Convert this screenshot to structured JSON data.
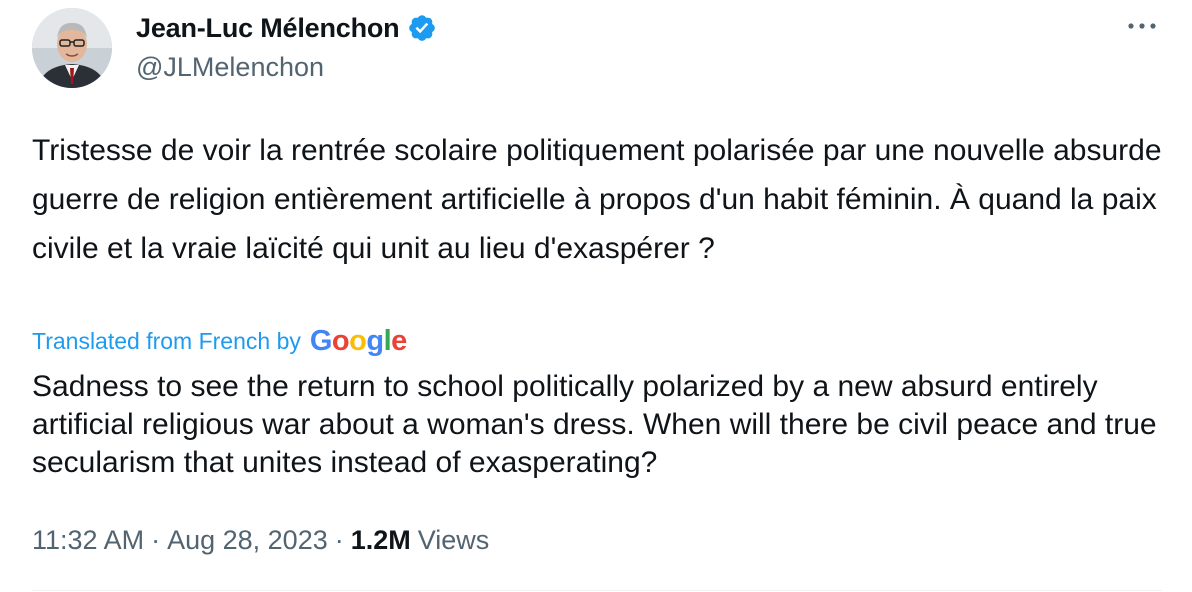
{
  "author": {
    "display_name": "Jean-Luc Mélenchon",
    "handle": "@JLMelenchon",
    "verified": true
  },
  "tweet": {
    "text": "Tristesse de voir la rentrée scolaire politiquement polarisée par une nouvelle absurde guerre de religion entièrement artificielle à propos d'un habit féminin. À quand la paix civile et la vraie laïcité qui unit au lieu d'exaspérer ?",
    "translated_label": "Translated from French by",
    "translator_brand": [
      "G",
      "o",
      "o",
      "g",
      "l",
      "e"
    ],
    "translation": "Sadness to see the return to school politically polarized by a new absurd entirely artificial religious war about a woman's dress. When will there be civil peace and true secularism that unites instead of exasperating?",
    "time": "11:32 AM",
    "date": "Aug 28, 2023",
    "separator": "·",
    "views_count": "1.2M",
    "views_label": "Views"
  },
  "icons": {
    "verified": "verified-badge-icon",
    "more": "more-options-icon"
  },
  "colors": {
    "accent": "#1d9bf0",
    "secondary_text": "#536471",
    "primary_text": "#0f1419",
    "google": [
      "#4285F4",
      "#EA4335",
      "#FBBC05",
      "#4285F4",
      "#34A853",
      "#EA4335"
    ]
  }
}
